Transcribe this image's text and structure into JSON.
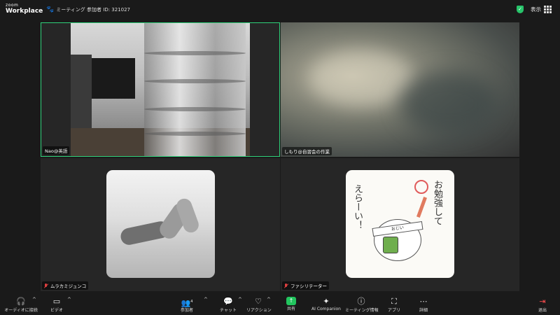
{
  "app": {
    "logo_small": "zoom",
    "logo_big": "Workplace",
    "meeting_title": "ミーティング 参加者 ID: 321027",
    "view_label": "表示"
  },
  "participants": [
    {
      "name": "Nao@英語",
      "muted": false,
      "active_speaker": true
    },
    {
      "name": "しもり@自習会の作業",
      "muted": false,
      "active_speaker": false
    },
    {
      "name": "ムラカミジュンコ",
      "muted": true,
      "active_speaker": false
    },
    {
      "name": "ファシリテーター",
      "muted": true,
      "active_speaker": false
    }
  ],
  "avatar4_text": {
    "right": "お勉強して",
    "left": "えらーい！",
    "headband": "おじい"
  },
  "toolbar": {
    "audio": "オーディオに接続",
    "video": "ビデオ",
    "participants": "参加者",
    "participants_count": "4",
    "chat": "チャット",
    "reactions": "リアクション",
    "share": "共有",
    "ai": "AI Companion",
    "info": "ミーティング情報",
    "apps": "アプリ",
    "more": "詳細",
    "exit": "退出"
  },
  "colors": {
    "active_border": "#2fd17a",
    "share_green": "#22c55e",
    "mute_red": "#e04040",
    "exit_red": "#ff4d4f",
    "shield_green": "#27c46a"
  },
  "icons": {
    "audio": "headphones-icon",
    "video": "camera-icon",
    "participants": "people-icon",
    "chat": "chat-icon",
    "reactions": "heart-icon",
    "share": "share-icon",
    "ai": "sparkle-icon",
    "info": "info-icon",
    "apps": "apps-icon",
    "more": "more-icon",
    "exit": "exit-icon",
    "security": "shield-icon"
  }
}
